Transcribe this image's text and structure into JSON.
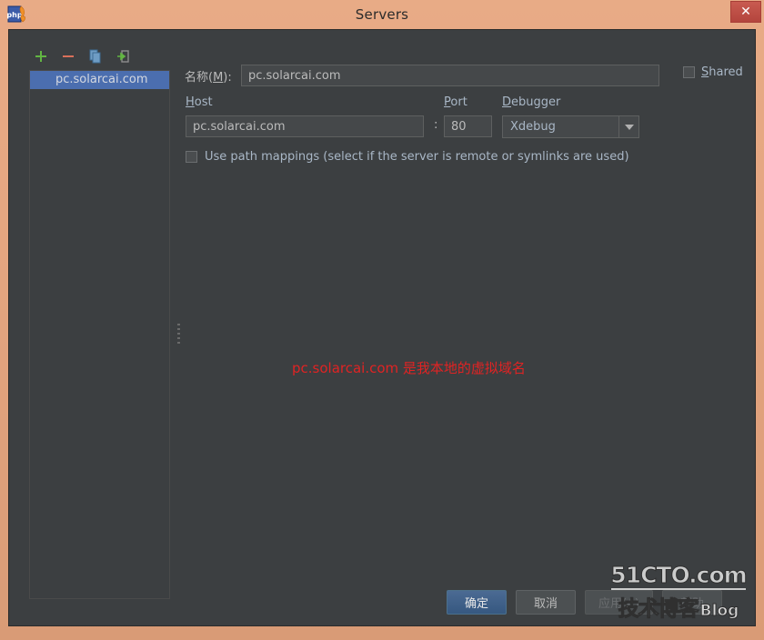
{
  "window": {
    "title": "Servers",
    "app_icon": "phpstorm-icon",
    "close_label": "✕"
  },
  "sidebar": {
    "toolbar": [
      {
        "name": "add-server-button",
        "glyph": "+"
      },
      {
        "name": "remove-server-button",
        "glyph": "−"
      },
      {
        "name": "copy-server-button",
        "glyph": "copy-icon"
      },
      {
        "name": "import-server-button",
        "glyph": "import-icon"
      }
    ],
    "items": [
      {
        "label": "pc.solarcai.com",
        "selected": true
      }
    ]
  },
  "form": {
    "name_label": "名称(",
    "name_mnemonic": "M",
    "name_label_suffix": "):",
    "name_value": "pc.solarcai.com",
    "shared_label_mnemonic": "S",
    "shared_label_rest": "hared",
    "shared_checked": false,
    "host_label_mnemonic": "H",
    "host_label_rest": "ost",
    "host_value": "pc.solarcai.com",
    "colon": ":",
    "port_label_mnemonic": "P",
    "port_label_rest": "ort",
    "port_value": "80",
    "debugger_label_mnemonic": "D",
    "debugger_label_rest": "ebugger",
    "debugger_value": "Xdebug",
    "path_mappings_label": "Use path mappings (select if the server is remote or symlinks are used)",
    "path_mappings_checked": false
  },
  "annotation": {
    "text": "pc.solarcai.com 是我本地的虚拟域名",
    "color": "#e02323"
  },
  "buttons": {
    "ok": "确定",
    "cancel": "取消",
    "apply": "应用(A)",
    "help": "帮助"
  },
  "watermark": {
    "line1": "51CTO.com",
    "line2": "技术博客",
    "line3": "Blog"
  },
  "colors": {
    "titlebar": "#e3a47f",
    "dialog_bg": "#3c3f41",
    "selection": "#4b6eaf",
    "text": "#bbbbbb",
    "label": "#a9b7c6",
    "close": "#b4453d",
    "accent_ok": "#365880",
    "annotation": "#e02323"
  }
}
